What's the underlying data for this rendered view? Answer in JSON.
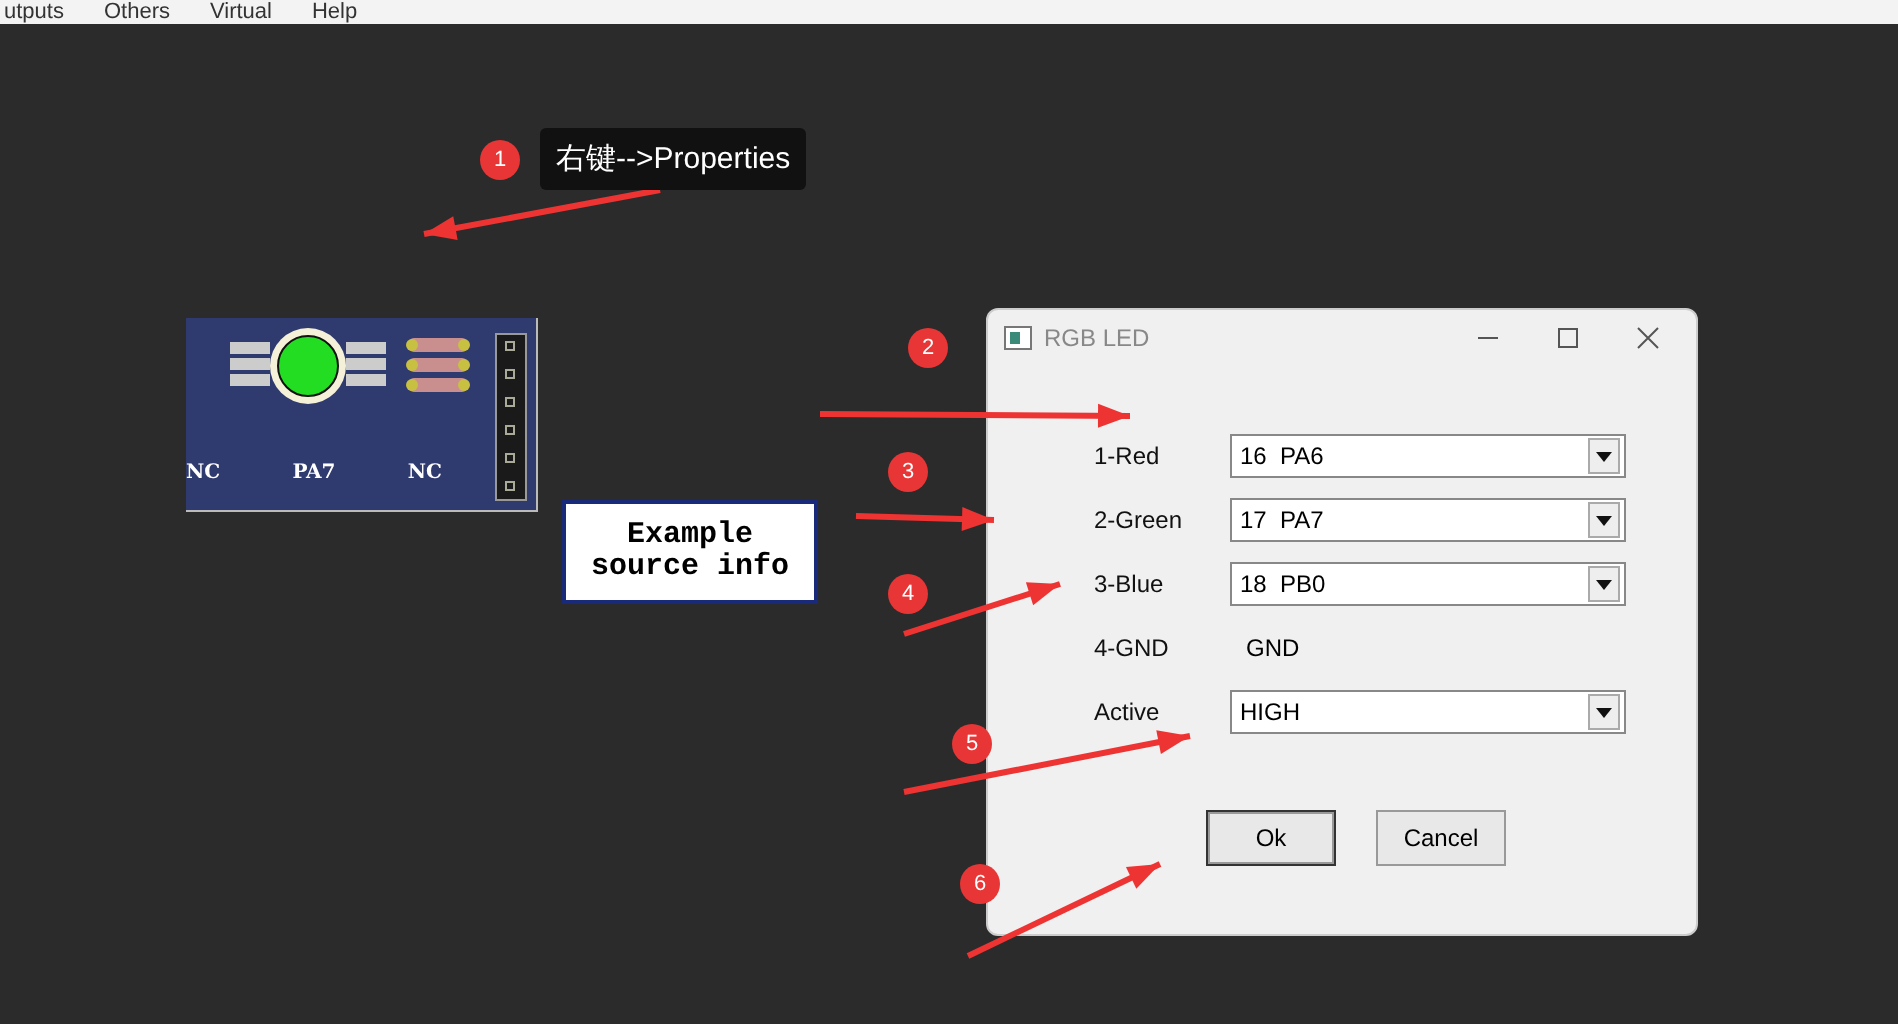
{
  "menu": [
    "utputs",
    "Others",
    "Virtual",
    "Help"
  ],
  "module": {
    "pins": [
      "NC",
      "PA7",
      "NC"
    ]
  },
  "note": {
    "lines": [
      "Example",
      "source info"
    ]
  },
  "callouts": [
    {
      "number": "1",
      "text": "右键-->Properties"
    },
    {
      "number": "2"
    },
    {
      "number": "3"
    },
    {
      "number": "4"
    },
    {
      "number": "5"
    },
    {
      "number": "6"
    }
  ],
  "dialog": {
    "title": "RGB LED",
    "rows": [
      {
        "kind": "combo",
        "label": "1-Red",
        "value": "16  PA6"
      },
      {
        "kind": "combo",
        "label": "2-Green",
        "value": "17  PA7"
      },
      {
        "kind": "combo",
        "label": "3-Blue",
        "value": "18  PB0"
      },
      {
        "kind": "text",
        "label": "4-GND",
        "value": "GND"
      },
      {
        "kind": "combo",
        "label": "Active",
        "value": "HIGH"
      }
    ],
    "buttons": [
      "Ok",
      "Cancel"
    ]
  }
}
